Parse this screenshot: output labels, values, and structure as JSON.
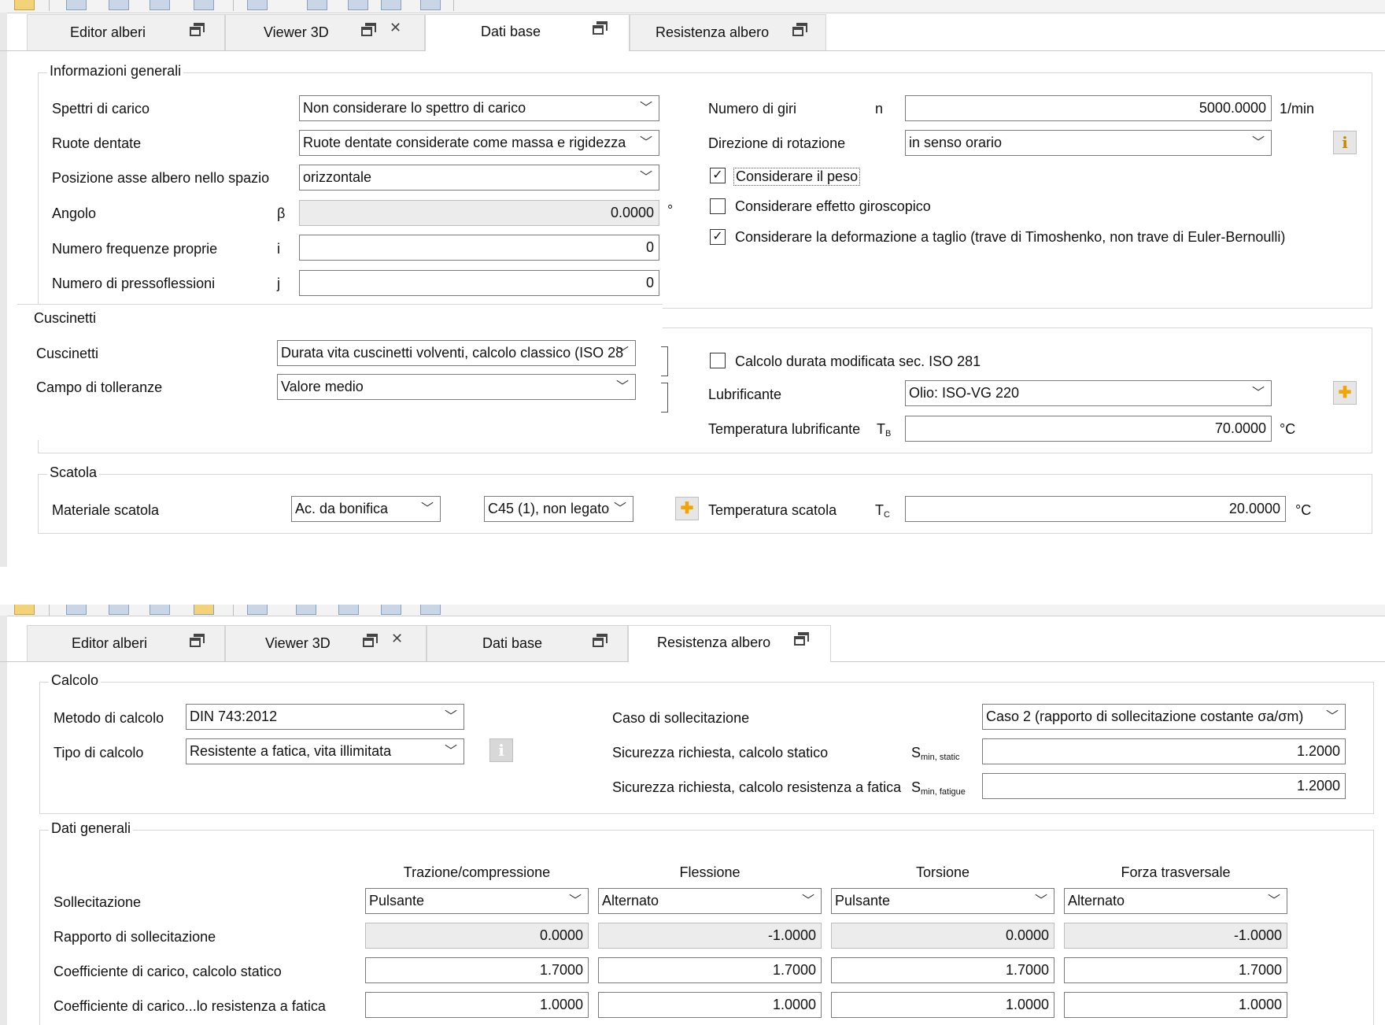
{
  "top": {
    "tabs": [
      {
        "label": "Editor alberi"
      },
      {
        "label": "Viewer 3D"
      },
      {
        "label": "Dati base"
      },
      {
        "label": "Resistenza albero"
      }
    ],
    "info_generali": {
      "title": "Informazioni generali",
      "spettri_label": "Spettri di carico",
      "spettri_value": "Non considerare lo spettro di carico",
      "ruote_label": "Ruote dentate",
      "ruote_value": "Ruote dentate considerate come massa e rigidezza",
      "posizione_label": "Posizione asse albero nello spazio",
      "posizione_value": "orizzontale",
      "angolo_label": "Angolo",
      "angolo_sym": "β",
      "angolo_value": "0.0000",
      "angolo_unit": "°",
      "freq_label": "Numero frequenze proprie",
      "freq_sym": "i",
      "freq_value": "0",
      "press_label": "Numero di pressoflessioni",
      "press_sym": "j",
      "press_value": "0",
      "giri_label": "Numero di giri",
      "giri_sym": "n",
      "giri_value": "5000.0000",
      "giri_unit": "1/min",
      "direzione_label": "Direzione di rotazione",
      "direzione_value": "in senso orario",
      "peso_label": "Considerare il peso",
      "peso_checked": true,
      "giro_label": "Considerare effetto giroscopico",
      "giro_checked": false,
      "taglio_label": "Considerare la deformazione a taglio (trave di Timoshenko, non trave di Euler-Bernoulli)",
      "taglio_checked": true
    },
    "cuscinetti": {
      "title": "Cuscinetti",
      "cuscinetti_label": "Cuscinetti",
      "cuscinetti_value": "Durata vita cuscinetti volventi, calcolo classico (ISO 28",
      "campo_label": "Campo di tolleranze",
      "campo_value": "Valore medio",
      "durata_label": "Calcolo durata modificata sec. ISO 281",
      "durata_checked": false,
      "lubrificante_label": "Lubrificante",
      "lubrificante_value": "Olio: ISO-VG 220",
      "temp_label": "Temperatura lubrificante",
      "temp_sym": "T",
      "temp_sub": "B",
      "temp_value": "70.0000",
      "temp_unit": "°C"
    },
    "scatola": {
      "title": "Scatola",
      "materiale_label": "Materiale scatola",
      "materiale_value1": "Ac. da bonifica",
      "materiale_value2": "C45 (1), non legato",
      "temp_label": "Temperatura scatola",
      "temp_sym": "T",
      "temp_sub": "C",
      "temp_value": "20.0000",
      "temp_unit": "°C"
    }
  },
  "bottom": {
    "tabs": [
      {
        "label": "Editor alberi"
      },
      {
        "label": "Viewer 3D"
      },
      {
        "label": "Dati base"
      },
      {
        "label": "Resistenza albero"
      }
    ],
    "calcolo": {
      "title": "Calcolo",
      "metodo_label": "Metodo di calcolo",
      "metodo_value": "DIN 743:2012",
      "tipo_label": "Tipo di calcolo",
      "tipo_value": "Resistente a fatica, vita illimitata",
      "caso_label": "Caso di sollecitazione",
      "caso_value": "Caso 2 (rapporto di sollecitazione costante σa/σm)",
      "sic_static_label": "Sicurezza richiesta, calcolo statico",
      "sic_static_sym": "S",
      "sic_static_sub": "min, static",
      "sic_static_value": "1.2000",
      "sic_fatigue_label": "Sicurezza richiesta, calcolo resistenza a fatica",
      "sic_fatigue_sym": "S",
      "sic_fatigue_sub": "min, fatigue",
      "sic_fatigue_value": "1.2000"
    },
    "dati_generali": {
      "title": "Dati generali",
      "columns": [
        "Trazione/compressione",
        "Flessione",
        "Torsione",
        "Forza trasversale"
      ],
      "rows": [
        {
          "label": "Sollecitazione",
          "values": [
            "Pulsante",
            "Alternato",
            "Pulsante",
            "Alternato"
          ]
        },
        {
          "label": "Rapporto di sollecitazione",
          "values": [
            "0.0000",
            "-1.0000",
            "0.0000",
            "-1.0000"
          ]
        },
        {
          "label": "Coefficiente di carico, calcolo statico",
          "values": [
            "1.7000",
            "1.7000",
            "1.7000",
            "1.7000"
          ]
        },
        {
          "label": "Coefficiente di carico...lo resistenza a fatica",
          "values": [
            "1.0000",
            "1.0000",
            "1.0000",
            "1.0000"
          ]
        }
      ]
    }
  }
}
